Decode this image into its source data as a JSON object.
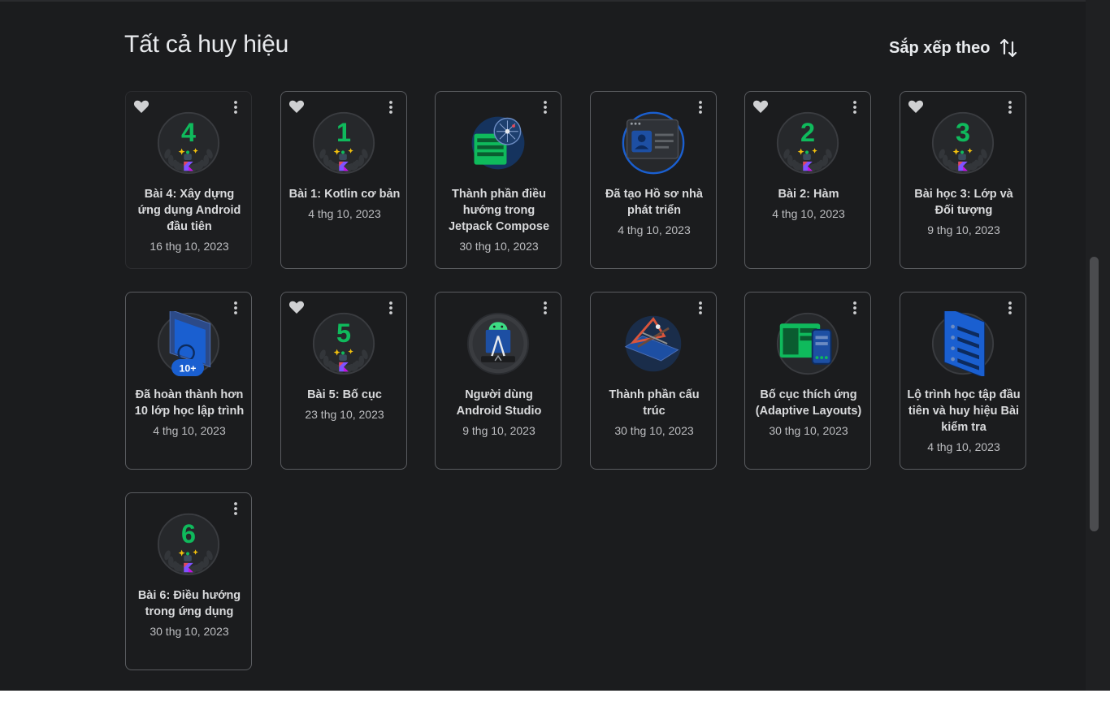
{
  "page": {
    "title": "Tất cả huy hiệu",
    "sort_label": "Sắp xếp theo"
  },
  "icons": {
    "favorite": "heart-icon",
    "more": "more-vert-icon",
    "sort": "sort-arrows-icon"
  },
  "colors": {
    "background": "#1b1c1e",
    "accent_green": "#0fba5c",
    "accent_blue": "#1a5fd0",
    "text": "#e8eaed"
  },
  "badges": [
    {
      "title": "Bài 4: Xây dựng ứng dụng Android đầu tiên",
      "date": "16 thg 10, 2023",
      "favorited": true,
      "badge_type": "number",
      "number": "4"
    },
    {
      "title": "Bài 1: Kotlin cơ bản",
      "date": "4 thg 10, 2023",
      "favorited": true,
      "badge_type": "number",
      "number": "1"
    },
    {
      "title": "Thành phần điều hướng trong Jetpack Compose",
      "date": "30 thg 10, 2023",
      "favorited": false,
      "badge_type": "navigation"
    },
    {
      "title": "Đã tạo Hồ sơ nhà phát triển",
      "date": "4 thg 10, 2023",
      "favorited": false,
      "badge_type": "profile"
    },
    {
      "title": "Bài 2: Hàm",
      "date": "4 thg 10, 2023",
      "favorited": true,
      "badge_type": "number",
      "number": "2"
    },
    {
      "title": "Bài học 3: Lớp và Đối tượng",
      "date": "9 thg 10, 2023",
      "favorited": true,
      "badge_type": "number",
      "number": "3"
    },
    {
      "title": "Đã hoàn thành hơn 10 lớp học lập trình",
      "date": "4 thg 10, 2023",
      "favorited": false,
      "badge_type": "codelabs",
      "pill": "10+"
    },
    {
      "title": "Bài 5: Bố cục",
      "date": "23 thg 10, 2023",
      "favorited": true,
      "badge_type": "number",
      "number": "5"
    },
    {
      "title": "Người dùng Android Studio",
      "date": "9 thg 10, 2023",
      "favorited": false,
      "badge_type": "studio"
    },
    {
      "title": "Thành phần cấu trúc",
      "date": "30 thg 10, 2023",
      "favorited": false,
      "badge_type": "architecture"
    },
    {
      "title": "Bố cục thích ứng (Adaptive Layouts)",
      "date": "30 thg 10, 2023",
      "favorited": false,
      "badge_type": "adaptive"
    },
    {
      "title": "Lộ trình học tập đầu tiên và huy hiệu Bài kiểm tra",
      "date": "4 thg 10, 2023",
      "favorited": false,
      "badge_type": "pathway"
    },
    {
      "title": "Bài 6: Điều hướng trong ứng dụng",
      "date": "30 thg 10, 2023",
      "favorited": false,
      "badge_type": "number",
      "number": "6"
    }
  ]
}
